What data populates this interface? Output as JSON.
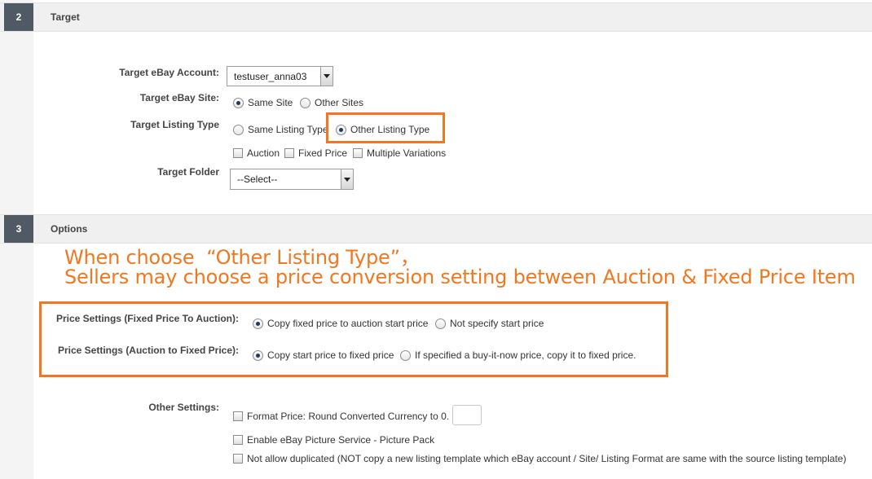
{
  "sections": [
    {
      "number": "2",
      "title": "Target"
    },
    {
      "number": "3",
      "title": "Options"
    }
  ],
  "target": {
    "account_label": "Target eBay Account:",
    "account_value": "testuser_anna03",
    "site_label": "Target eBay Site:",
    "site_options": [
      "Same Site",
      "Other Sites"
    ],
    "listing_type_label": "Target Listing Type",
    "listing_type_options": [
      "Same Listing Type",
      "Other Listing Type"
    ],
    "format_checks": [
      "Auction",
      "Fixed Price",
      "Multiple Variations"
    ],
    "folder_label": "Target Folder",
    "folder_value": "--Select--"
  },
  "annotation": {
    "line1": "When choose  “Other Listing Type”，",
    "line2": "Sellers may choose a price conversion setting between Auction & Fixed Price Item",
    "color": "#f07820"
  },
  "options": {
    "price_fp_to_auction_label": "Price Settings (Fixed Price To Auction):",
    "price_fp_to_auction_options": [
      "Copy fixed price to auction start price",
      "Not specify start price"
    ],
    "price_auction_to_fp_label": "Price Settings (Auction to Fixed Price):",
    "price_auction_to_fp_options": [
      "Copy start price to fixed price",
      "If specified a buy-it-now price, copy it to fixed price."
    ],
    "other_label": "Other Settings:",
    "other_checks": [
      "Format Price: Round Converted Currency to 0.",
      "Enable eBay Picture Service - Picture Pack",
      "Not allow duplicated (NOT copy a new listing template which eBay account / Site/ Listing Format are same with the source listing template)"
    ]
  },
  "colors": {
    "accent": "#f07820",
    "section_number_bg": "#505a64"
  }
}
